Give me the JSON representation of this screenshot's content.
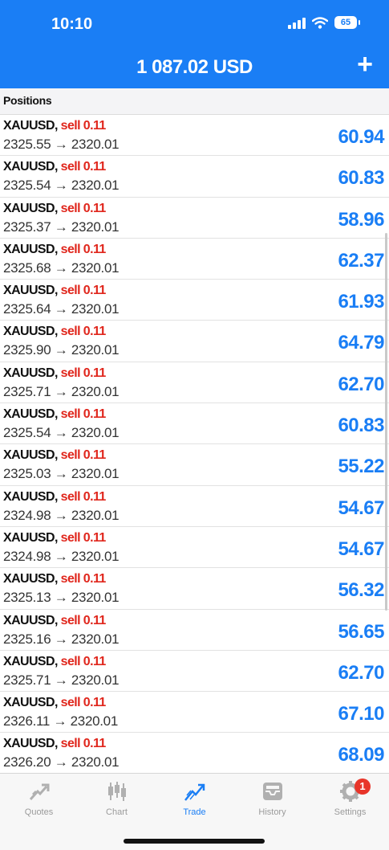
{
  "status_bar": {
    "time": "10:10",
    "battery": "65"
  },
  "header": {
    "title": "1 087.02 USD",
    "add_label": "+"
  },
  "section": {
    "title": "Positions"
  },
  "positions": [
    {
      "symbol": "XAUUSD,",
      "type": "sell 0.11",
      "prices": "2325.55 → 2320.01",
      "profit": "60.94"
    },
    {
      "symbol": "XAUUSD,",
      "type": "sell 0.11",
      "prices": "2325.54 → 2320.01",
      "profit": "60.83"
    },
    {
      "symbol": "XAUUSD,",
      "type": "sell 0.11",
      "prices": "2325.37 → 2320.01",
      "profit": "58.96"
    },
    {
      "symbol": "XAUUSD,",
      "type": "sell 0.11",
      "prices": "2325.68 → 2320.01",
      "profit": "62.37"
    },
    {
      "symbol": "XAUUSD,",
      "type": "sell 0.11",
      "prices": "2325.64 → 2320.01",
      "profit": "61.93"
    },
    {
      "symbol": "XAUUSD,",
      "type": "sell 0.11",
      "prices": "2325.90 → 2320.01",
      "profit": "64.79"
    },
    {
      "symbol": "XAUUSD,",
      "type": "sell 0.11",
      "prices": "2325.71 → 2320.01",
      "profit": "62.70"
    },
    {
      "symbol": "XAUUSD,",
      "type": "sell 0.11",
      "prices": "2325.54 → 2320.01",
      "profit": "60.83"
    },
    {
      "symbol": "XAUUSD,",
      "type": "sell 0.11",
      "prices": "2325.03 → 2320.01",
      "profit": "55.22"
    },
    {
      "symbol": "XAUUSD,",
      "type": "sell 0.11",
      "prices": "2324.98 → 2320.01",
      "profit": "54.67"
    },
    {
      "symbol": "XAUUSD,",
      "type": "sell 0.11",
      "prices": "2324.98 → 2320.01",
      "profit": "54.67"
    },
    {
      "symbol": "XAUUSD,",
      "type": "sell 0.11",
      "prices": "2325.13 → 2320.01",
      "profit": "56.32"
    },
    {
      "symbol": "XAUUSD,",
      "type": "sell 0.11",
      "prices": "2325.16 → 2320.01",
      "profit": "56.65"
    },
    {
      "symbol": "XAUUSD,",
      "type": "sell 0.11",
      "prices": "2325.71 → 2320.01",
      "profit": "62.70"
    },
    {
      "symbol": "XAUUSD,",
      "type": "sell 0.11",
      "prices": "2326.11 → 2320.01",
      "profit": "67.10"
    },
    {
      "symbol": "XAUUSD,",
      "type": "sell 0.11",
      "prices": "2326.20 → 2320.01",
      "profit": "68.09"
    }
  ],
  "tabs": [
    {
      "label": "Quotes",
      "icon": "quotes-icon",
      "active": false
    },
    {
      "label": "Chart",
      "icon": "chart-icon",
      "active": false
    },
    {
      "label": "Trade",
      "icon": "trade-icon",
      "active": true
    },
    {
      "label": "History",
      "icon": "history-icon",
      "active": false
    },
    {
      "label": "Settings",
      "icon": "gear-icon",
      "active": false,
      "badge": "1"
    }
  ],
  "colors": {
    "accent": "#1a7ef5",
    "sell": "#e0261c",
    "profit": "#1a7ef5",
    "tab_inactive": "#9b9b9b"
  }
}
